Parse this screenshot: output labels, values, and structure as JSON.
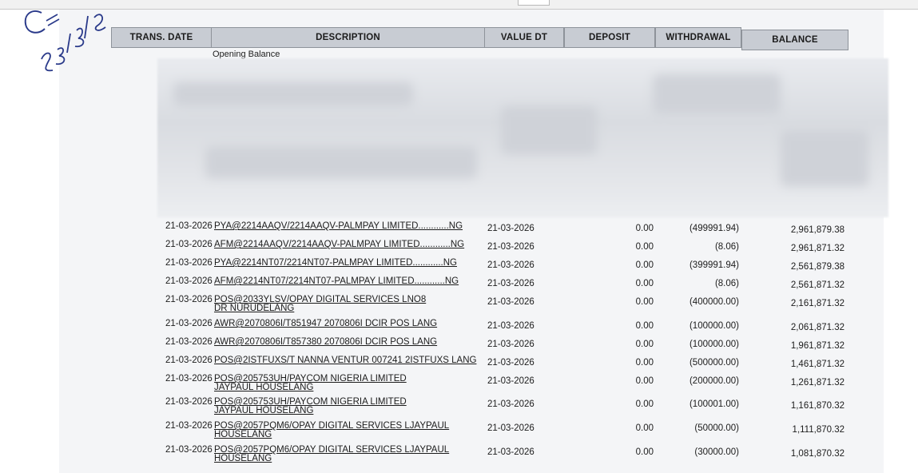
{
  "handwriting": {
    "initials": "Ok",
    "date": "23/03/26"
  },
  "headers": {
    "trans_date": "TRANS. DATE",
    "description": "DESCRIPTION",
    "value_dt": "VALUE DT",
    "deposit": "DEPOSIT",
    "withdrawal": "WITHDRAWAL",
    "balance": "BALANCE"
  },
  "opening_balance_label": "Opening Balance",
  "rows": [
    {
      "date": "21-03-2026",
      "description": "PYA@2214AAQV/2214AAQV-PALMPAY LIMITED............NG",
      "value_dt": "21-03-2026",
      "deposit": "0.00",
      "withdrawal": "(499991.94)",
      "balance": "2,961,879.38"
    },
    {
      "date": "21-03-2026",
      "description": "AFM@2214AAQV/2214AAQV-PALMPAY LIMITED............NG",
      "value_dt": "21-03-2026",
      "deposit": "0.00",
      "withdrawal": "(8.06)",
      "balance": "2,961,871.32"
    },
    {
      "date": "21-03-2026",
      "description": "PYA@2214NT07/2214NT07-PALMPAY LIMITED............NG",
      "value_dt": "21-03-2026",
      "deposit": "0.00",
      "withdrawal": "(399991.94)",
      "balance": "2,561,879.38"
    },
    {
      "date": "21-03-2026",
      "description": "AFM@2214NT07/2214NT07-PALMPAY LIMITED............NG",
      "value_dt": "21-03-2026",
      "deposit": "0.00",
      "withdrawal": "(8.06)",
      "balance": "2,561,871.32"
    },
    {
      "date": "21-03-2026",
      "description": "POS@2033YLSV/OPAY DIGITAL SERVICES LNO8 DR NURUDELANG",
      "value_dt": "21-03-2026",
      "deposit": "0.00",
      "withdrawal": "(400000.00)",
      "balance": "2,161,871.32"
    },
    {
      "date": "21-03-2026",
      "description": "AWR@2070806I/T851947 2070806I DCIR POS LANG",
      "value_dt": "21-03-2026",
      "deposit": "0.00",
      "withdrawal": "(100000.00)",
      "balance": "2,061,871.32"
    },
    {
      "date": "21-03-2026",
      "description": "AWR@2070806I/T857380 2070806I DCIR POS LANG",
      "value_dt": "21-03-2026",
      "deposit": "0.00",
      "withdrawal": "(100000.00)",
      "balance": "1,961,871.32"
    },
    {
      "date": "21-03-2026",
      "description": "POS@2ISTFUXS/T NANNA VENTUR 007241 2ISTFUXS LANG",
      "value_dt": "21-03-2026",
      "deposit": "0.00",
      "withdrawal": "(500000.00)",
      "balance": "1,461,871.32"
    },
    {
      "date": "21-03-2026",
      "description": "POS@205753UH/PAYCOM NIGERIA LIMITED JAYPAUL HOUSELANG",
      "value_dt": "21-03-2026",
      "deposit": "0.00",
      "withdrawal": "(200000.00)",
      "balance": "1,261,871.32"
    },
    {
      "date": "21-03-2026",
      "description": "POS@205753UH/PAYCOM NIGERIA LIMITED JAYPAUL HOUSELANG",
      "value_dt": "21-03-2026",
      "deposit": "0.00",
      "withdrawal": "(100001.00)",
      "balance": "1,161,870.32"
    },
    {
      "date": "21-03-2026",
      "description": "POS@2057PQM6/OPAY DIGITAL SERVICES LJAYPAUL HOUSELANG",
      "value_dt": "21-03-2026",
      "deposit": "0.00",
      "withdrawal": "(50000.00)",
      "balance": "1,111,870.32"
    },
    {
      "date": "21-03-2026",
      "description": "POS@2057PQM6/OPAY DIGITAL SERVICES LJAYPAUL HOUSELANG",
      "value_dt": "21-03-2026",
      "deposit": "0.00",
      "withdrawal": "(30000.00)",
      "balance": "1,081,870.32"
    }
  ]
}
